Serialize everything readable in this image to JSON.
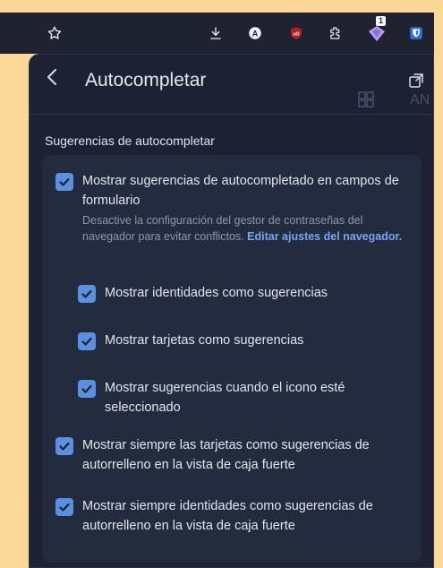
{
  "header": {
    "title": "Autocompletar",
    "badge": "AN"
  },
  "toolbar": {
    "notif_count": "1"
  },
  "section_title": "Sugerencias de autocompletar",
  "options": [
    {
      "label": "Mostrar sugerencias de autocompletado en campos de formulario",
      "checked": true
    },
    {
      "label": "Mostrar identidades como sugerencias",
      "checked": true
    },
    {
      "label": "Mostrar tarjetas como sugerencias",
      "checked": true
    },
    {
      "label": "Mostrar sugerencias cuando el icono esté seleccionado",
      "checked": true
    },
    {
      "label": "Mostrar siempre las tarjetas como sugerencias de autorrelleno en la vista de caja fuerte",
      "checked": true
    },
    {
      "label": "Mostrar siempre identidades como sugerencias de autorrelleno en la vista de caja fuerte",
      "checked": true
    }
  ],
  "help": {
    "text": "Desactive la configuración del gestor de contraseñas del navegador para evitar conflictos.",
    "link": "Editar ajustes del navegador."
  },
  "colors": {
    "accent": "#5b8fe0",
    "panel": "#1c2233",
    "card": "#232b3e",
    "background": "#fbd896"
  }
}
